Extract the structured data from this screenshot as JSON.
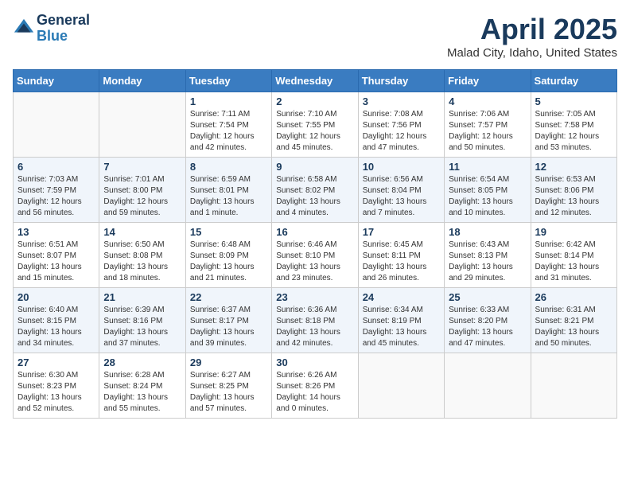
{
  "header": {
    "logo_general": "General",
    "logo_blue": "Blue",
    "main_title": "April 2025",
    "subtitle": "Malad City, Idaho, United States"
  },
  "weekdays": [
    "Sunday",
    "Monday",
    "Tuesday",
    "Wednesday",
    "Thursday",
    "Friday",
    "Saturday"
  ],
  "weeks": [
    [
      {
        "day": "",
        "sunrise": "",
        "sunset": "",
        "daylight": ""
      },
      {
        "day": "",
        "sunrise": "",
        "sunset": "",
        "daylight": ""
      },
      {
        "day": "1",
        "sunrise": "Sunrise: 7:11 AM",
        "sunset": "Sunset: 7:54 PM",
        "daylight": "Daylight: 12 hours and 42 minutes."
      },
      {
        "day": "2",
        "sunrise": "Sunrise: 7:10 AM",
        "sunset": "Sunset: 7:55 PM",
        "daylight": "Daylight: 12 hours and 45 minutes."
      },
      {
        "day": "3",
        "sunrise": "Sunrise: 7:08 AM",
        "sunset": "Sunset: 7:56 PM",
        "daylight": "Daylight: 12 hours and 47 minutes."
      },
      {
        "day": "4",
        "sunrise": "Sunrise: 7:06 AM",
        "sunset": "Sunset: 7:57 PM",
        "daylight": "Daylight: 12 hours and 50 minutes."
      },
      {
        "day": "5",
        "sunrise": "Sunrise: 7:05 AM",
        "sunset": "Sunset: 7:58 PM",
        "daylight": "Daylight: 12 hours and 53 minutes."
      }
    ],
    [
      {
        "day": "6",
        "sunrise": "Sunrise: 7:03 AM",
        "sunset": "Sunset: 7:59 PM",
        "daylight": "Daylight: 12 hours and 56 minutes."
      },
      {
        "day": "7",
        "sunrise": "Sunrise: 7:01 AM",
        "sunset": "Sunset: 8:00 PM",
        "daylight": "Daylight: 12 hours and 59 minutes."
      },
      {
        "day": "8",
        "sunrise": "Sunrise: 6:59 AM",
        "sunset": "Sunset: 8:01 PM",
        "daylight": "Daylight: 13 hours and 1 minute."
      },
      {
        "day": "9",
        "sunrise": "Sunrise: 6:58 AM",
        "sunset": "Sunset: 8:02 PM",
        "daylight": "Daylight: 13 hours and 4 minutes."
      },
      {
        "day": "10",
        "sunrise": "Sunrise: 6:56 AM",
        "sunset": "Sunset: 8:04 PM",
        "daylight": "Daylight: 13 hours and 7 minutes."
      },
      {
        "day": "11",
        "sunrise": "Sunrise: 6:54 AM",
        "sunset": "Sunset: 8:05 PM",
        "daylight": "Daylight: 13 hours and 10 minutes."
      },
      {
        "day": "12",
        "sunrise": "Sunrise: 6:53 AM",
        "sunset": "Sunset: 8:06 PM",
        "daylight": "Daylight: 13 hours and 12 minutes."
      }
    ],
    [
      {
        "day": "13",
        "sunrise": "Sunrise: 6:51 AM",
        "sunset": "Sunset: 8:07 PM",
        "daylight": "Daylight: 13 hours and 15 minutes."
      },
      {
        "day": "14",
        "sunrise": "Sunrise: 6:50 AM",
        "sunset": "Sunset: 8:08 PM",
        "daylight": "Daylight: 13 hours and 18 minutes."
      },
      {
        "day": "15",
        "sunrise": "Sunrise: 6:48 AM",
        "sunset": "Sunset: 8:09 PM",
        "daylight": "Daylight: 13 hours and 21 minutes."
      },
      {
        "day": "16",
        "sunrise": "Sunrise: 6:46 AM",
        "sunset": "Sunset: 8:10 PM",
        "daylight": "Daylight: 13 hours and 23 minutes."
      },
      {
        "day": "17",
        "sunrise": "Sunrise: 6:45 AM",
        "sunset": "Sunset: 8:11 PM",
        "daylight": "Daylight: 13 hours and 26 minutes."
      },
      {
        "day": "18",
        "sunrise": "Sunrise: 6:43 AM",
        "sunset": "Sunset: 8:13 PM",
        "daylight": "Daylight: 13 hours and 29 minutes."
      },
      {
        "day": "19",
        "sunrise": "Sunrise: 6:42 AM",
        "sunset": "Sunset: 8:14 PM",
        "daylight": "Daylight: 13 hours and 31 minutes."
      }
    ],
    [
      {
        "day": "20",
        "sunrise": "Sunrise: 6:40 AM",
        "sunset": "Sunset: 8:15 PM",
        "daylight": "Daylight: 13 hours and 34 minutes."
      },
      {
        "day": "21",
        "sunrise": "Sunrise: 6:39 AM",
        "sunset": "Sunset: 8:16 PM",
        "daylight": "Daylight: 13 hours and 37 minutes."
      },
      {
        "day": "22",
        "sunrise": "Sunrise: 6:37 AM",
        "sunset": "Sunset: 8:17 PM",
        "daylight": "Daylight: 13 hours and 39 minutes."
      },
      {
        "day": "23",
        "sunrise": "Sunrise: 6:36 AM",
        "sunset": "Sunset: 8:18 PM",
        "daylight": "Daylight: 13 hours and 42 minutes."
      },
      {
        "day": "24",
        "sunrise": "Sunrise: 6:34 AM",
        "sunset": "Sunset: 8:19 PM",
        "daylight": "Daylight: 13 hours and 45 minutes."
      },
      {
        "day": "25",
        "sunrise": "Sunrise: 6:33 AM",
        "sunset": "Sunset: 8:20 PM",
        "daylight": "Daylight: 13 hours and 47 minutes."
      },
      {
        "day": "26",
        "sunrise": "Sunrise: 6:31 AM",
        "sunset": "Sunset: 8:21 PM",
        "daylight": "Daylight: 13 hours and 50 minutes."
      }
    ],
    [
      {
        "day": "27",
        "sunrise": "Sunrise: 6:30 AM",
        "sunset": "Sunset: 8:23 PM",
        "daylight": "Daylight: 13 hours and 52 minutes."
      },
      {
        "day": "28",
        "sunrise": "Sunrise: 6:28 AM",
        "sunset": "Sunset: 8:24 PM",
        "daylight": "Daylight: 13 hours and 55 minutes."
      },
      {
        "day": "29",
        "sunrise": "Sunrise: 6:27 AM",
        "sunset": "Sunset: 8:25 PM",
        "daylight": "Daylight: 13 hours and 57 minutes."
      },
      {
        "day": "30",
        "sunrise": "Sunrise: 6:26 AM",
        "sunset": "Sunset: 8:26 PM",
        "daylight": "Daylight: 14 hours and 0 minutes."
      },
      {
        "day": "",
        "sunrise": "",
        "sunset": "",
        "daylight": ""
      },
      {
        "day": "",
        "sunrise": "",
        "sunset": "",
        "daylight": ""
      },
      {
        "day": "",
        "sunrise": "",
        "sunset": "",
        "daylight": ""
      }
    ]
  ]
}
